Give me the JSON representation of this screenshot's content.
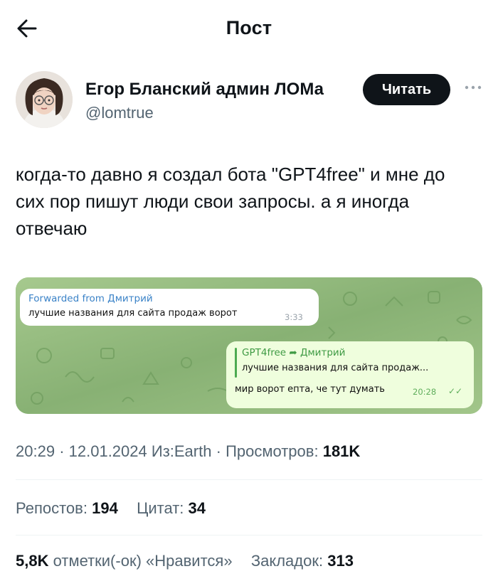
{
  "header": {
    "title": "Пост"
  },
  "author": {
    "name": "Егор Бланский админ ЛОМа",
    "handle": "@lomtrue",
    "follow_label": "Читать"
  },
  "tweet": {
    "text": "когда-то давно я создал бота \"GPT4free\" и мне до сих пор пишут люди свои запросы. а я иногда отвечаю"
  },
  "media": {
    "incoming": {
      "forwarded_from": "Forwarded from Дмитрий",
      "message": "лучшие названия для сайта продаж ворот",
      "time": "3:33"
    },
    "outgoing": {
      "reply_header": "GPT4free ➦ Дмитрий",
      "quoted": "лучшие названия для сайта продаж...",
      "message": "мир ворот епта, че тут думать",
      "time": "20:28",
      "ticks": "✓✓"
    }
  },
  "meta": {
    "time": "20:29",
    "date": "12.01.2024",
    "source": "Из:Earth",
    "views_label": "Просмотров:",
    "views": "181K"
  },
  "stats": {
    "reposts_count": "194",
    "reposts_label": "Репостов:",
    "quotes_count": "34",
    "quotes_label": "Цитат:",
    "likes_count": "5,8K",
    "likes_label": "отметки(-ок) «Нравится»",
    "bookmarks_label": "Закладок:",
    "bookmarks_count": "313"
  },
  "colors": {
    "text_primary": "#0f1419",
    "text_secondary": "#536471",
    "follow_button": "#0f1419",
    "telegram_bg": "#8fb57b",
    "link_blue": "#3a82c7",
    "outgoing_bubble": "#effedd"
  },
  "icons": [
    "back-arrow-icon",
    "more-dots-icon",
    "double-check-icon"
  ]
}
